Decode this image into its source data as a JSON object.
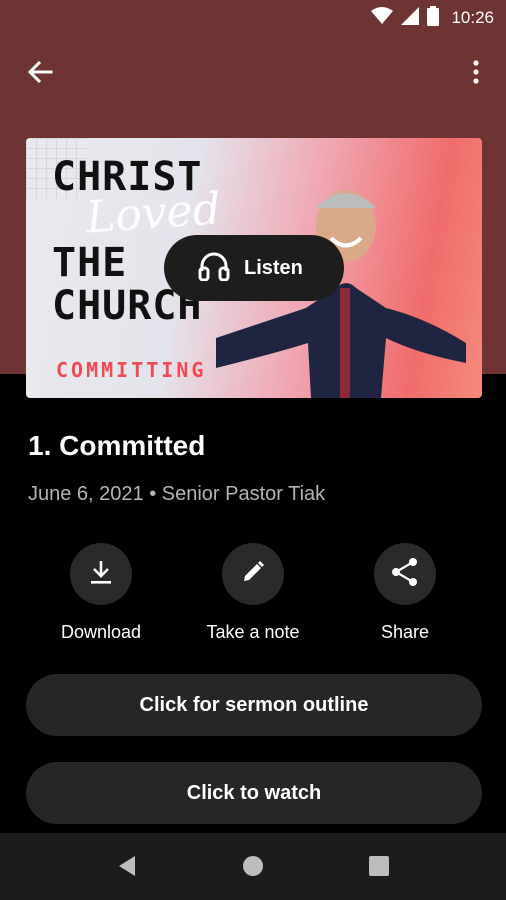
{
  "status_bar": {
    "time": "10:26"
  },
  "artwork": {
    "title_lines": [
      "CHRIST",
      "THE",
      "CHURCH"
    ],
    "script_text": "Loved",
    "subtitle": "COMMITTING"
  },
  "listen": {
    "label": "Listen"
  },
  "sermon": {
    "title": "1. Committed",
    "meta": "June 6, 2021 • Senior Pastor Tiak"
  },
  "actions": [
    {
      "label": "Download",
      "icon": "download-icon"
    },
    {
      "label": "Take a note",
      "icon": "pencil-icon"
    },
    {
      "label": "Share",
      "icon": "share-icon"
    }
  ],
  "buttons": {
    "outline_label": "Click for sermon outline",
    "watch_label": "Click to watch"
  },
  "colors": {
    "header_bg": "#6e3434",
    "background": "#000000",
    "button_bg": "#262626",
    "accent_red": "#ef4a56"
  }
}
